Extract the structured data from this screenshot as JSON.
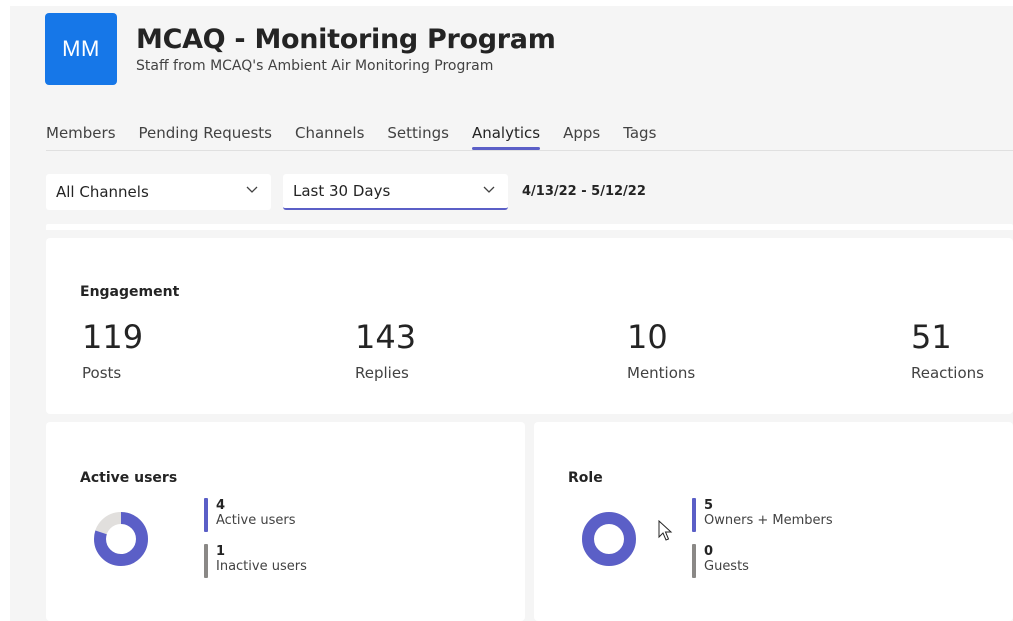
{
  "header": {
    "avatar_initials": "MM",
    "title": "MCAQ - Monitoring Program",
    "more_glyph": "···",
    "subtitle": "Staff from MCAQ's Ambient Air Monitoring Program"
  },
  "tabs": [
    {
      "label": "Members",
      "active": false
    },
    {
      "label": "Pending Requests",
      "active": false
    },
    {
      "label": "Channels",
      "active": false
    },
    {
      "label": "Settings",
      "active": false
    },
    {
      "label": "Analytics",
      "active": true
    },
    {
      "label": "Apps",
      "active": false
    },
    {
      "label": "Tags",
      "active": false
    }
  ],
  "filters": {
    "channel_select": "All Channels",
    "range_select": "Last 30 Days",
    "date_range": "4/13/22 - 5/12/22"
  },
  "engagement": {
    "title": "Engagement",
    "stats": [
      {
        "value": "119",
        "label": "Posts"
      },
      {
        "value": "143",
        "label": "Replies"
      },
      {
        "value": "10",
        "label": "Mentions"
      },
      {
        "value": "51",
        "label": "Reactions"
      }
    ]
  },
  "active_users": {
    "title": "Active users",
    "items": [
      {
        "value": "4",
        "label": "Active users",
        "color": "#5b5fc7"
      },
      {
        "value": "1",
        "label": "Inactive users",
        "color": "#8a8886"
      }
    ],
    "donut": {
      "fraction_primary": 0.8,
      "primary_color": "#5b5fc7",
      "secondary_color": "#e1dfdd"
    }
  },
  "role": {
    "title": "Role",
    "items": [
      {
        "value": "5",
        "label": "Owners + Members",
        "color": "#5b5fc7"
      },
      {
        "value": "0",
        "label": "Guests",
        "color": "#8a8886"
      }
    ],
    "donut": {
      "fraction_primary": 1.0,
      "primary_color": "#5b5fc7",
      "secondary_color": "#e1dfdd"
    }
  },
  "colors": {
    "accent": "#5b5fc7",
    "avatar_bg": "#1677e8",
    "background": "#f5f5f5"
  },
  "icons": {
    "more": "more-horizontal-icon",
    "chevron": "chevron-down-icon",
    "cursor": "mouse-pointer-icon"
  }
}
